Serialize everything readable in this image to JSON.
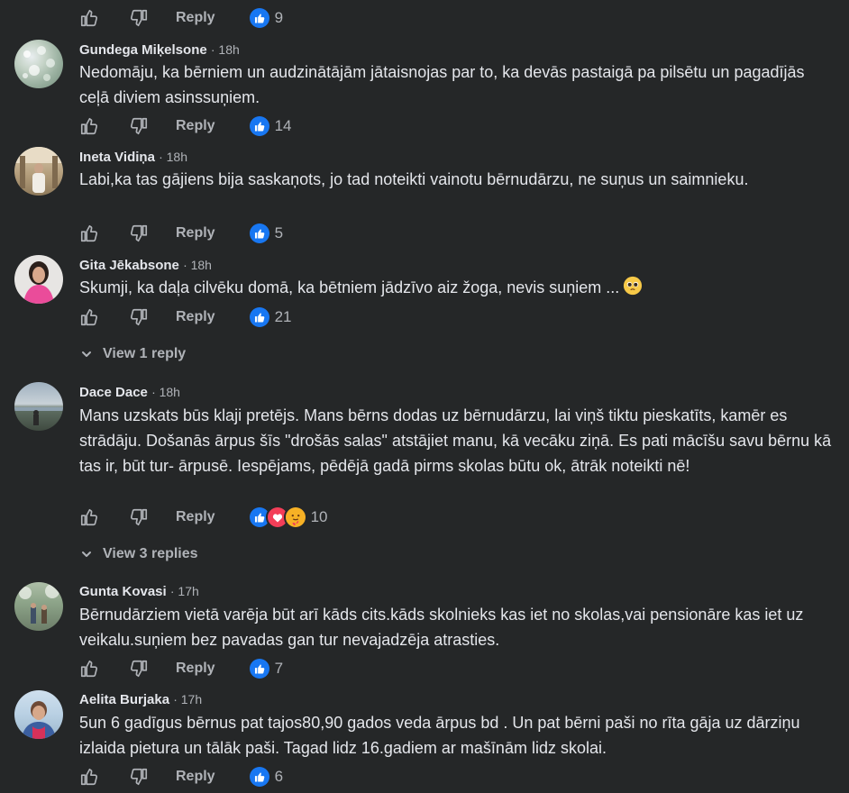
{
  "top": {
    "reply_label": "Reply",
    "reaction_count": "9"
  },
  "comments": [
    {
      "author": "Gundega Miķelsone",
      "time": "· 18h",
      "text": "Nedomāju, ka bērniem un audzinātājām jātaisnojas par to, ka devās pastaigā pa pilsētu un pagadījās ceļā diviem asinssuņiem.",
      "reply_label": "Reply",
      "reaction_count": "14"
    },
    {
      "author": "Ineta Vidiņa",
      "time": "· 18h",
      "text": "Labi,ka tas gājiens bija saskaņots, jo tad noteikti vainotu bērnudārzu, ne suņus un saimnieku.",
      "reply_label": "Reply",
      "reaction_count": "5"
    },
    {
      "author": "Gita Jēkabsone",
      "time": "· 18h",
      "text": "Skumji, ka daļa cilvēku domā, ka bētniem jādzīvo aiz žoga, nevis suņiem ...",
      "reply_label": "Reply",
      "reaction_count": "21",
      "view_replies": "View 1 reply"
    },
    {
      "author": "Dace Dace",
      "time": "· 18h",
      "text": "Mans uzskats būs klaji pretējs. Mans bērns dodas uz bērnudārzu, lai viņš tiktu pieskatīts, kamēr es strādāju. Došanās ārpus šīs \"drošās salas\" atstājiet manu, kā vecāku ziņā. Es pati mācīšu savu bērnu kā tas ir, būt tur- ārpusē. Iespējams, pēdējā gadā pirms skolas būtu ok, ātrāk noteikti nē!",
      "reply_label": "Reply",
      "reaction_count": "10",
      "view_replies": "View 3 replies"
    },
    {
      "author": "Gunta Kovasi",
      "time": "· 17h",
      "text": "Bērnudārziem vietā varēja būt arī kāds cits.kāds skolnieks kas iet no skolas,vai pensionāre kas iet uz veikalu.suņiem bez pavadas gan tur nevajadzēja atrasties.",
      "reply_label": "Reply",
      "reaction_count": "7"
    },
    {
      "author": "Aelita Burjaka",
      "time": "· 17h",
      "text": "5un 6 gadīgus bērnus pat tajos80,90 gados veda ārpus bd . Un pat bērni paši no rīta gāja uz dārziņu izlaida pietura un tālāk paši. Tagad lidz 16.gadiem ar mašīnām lidz skolai.",
      "reply_label": "Reply",
      "reaction_count": "6"
    }
  ],
  "colors": {
    "background": "#252728",
    "text": "#e4e6eb",
    "muted": "#b0b3b8",
    "like_blue": "#1877f2"
  }
}
